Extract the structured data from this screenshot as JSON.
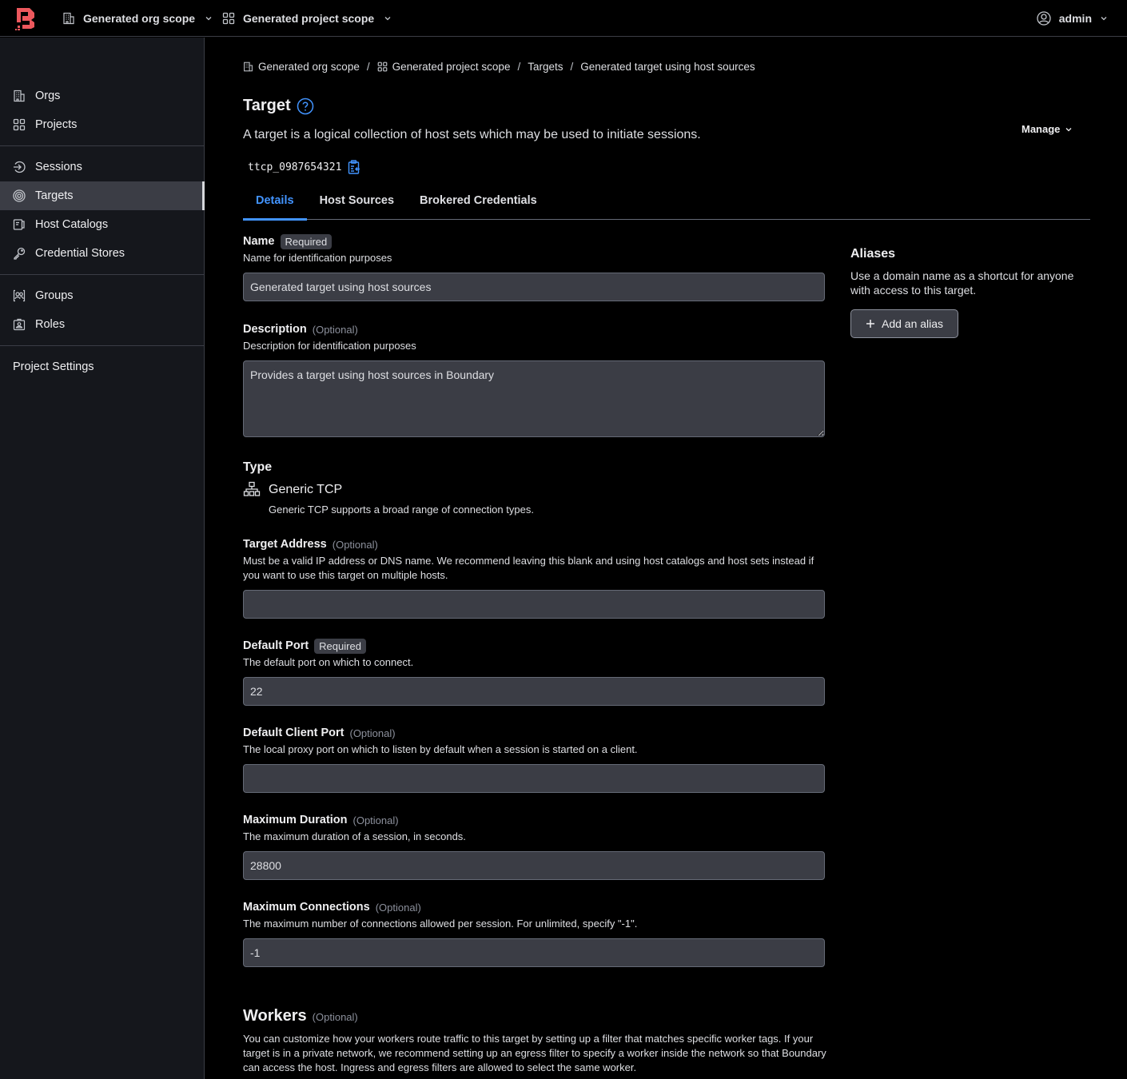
{
  "header": {
    "org_scope": "Generated org scope",
    "project_scope": "Generated project scope",
    "user": "admin",
    "brand_color": "#ec585d"
  },
  "sidebar": {
    "groups": [
      [
        {
          "label": "Orgs",
          "icon": "building-icon"
        },
        {
          "label": "Projects",
          "icon": "grid-icon"
        }
      ],
      [
        {
          "label": "Sessions",
          "icon": "entry-point-icon"
        },
        {
          "label": "Targets",
          "icon": "target-icon",
          "active": true
        },
        {
          "label": "Host Catalogs",
          "icon": "server-cluster-icon"
        },
        {
          "label": "Credential Stores",
          "icon": "key-icon"
        }
      ],
      [
        {
          "label": "Groups",
          "icon": "users-icon"
        },
        {
          "label": "Roles",
          "icon": "id-card-icon"
        }
      ],
      [
        {
          "label": "Project Settings"
        }
      ]
    ]
  },
  "breadcrumb": [
    "Generated org scope",
    "Generated project scope",
    "Targets",
    "Generated target using host sources"
  ],
  "page": {
    "title": "Target",
    "subtitle": "A target is a logical collection of host sets which may be used to initiate sessions.",
    "manage_label": "Manage",
    "target_id": "ttcp_0987654321",
    "accent_color": "#4294ff"
  },
  "tabs": [
    {
      "label": "Details",
      "active": true
    },
    {
      "label": "Host Sources"
    },
    {
      "label": "Brokered Credentials"
    }
  ],
  "form": {
    "required_badge": "Required",
    "optional_label": "(Optional)",
    "name": {
      "label": "Name",
      "helper": "Name for identification purposes",
      "value": "Generated target using host sources"
    },
    "description": {
      "label": "Description",
      "helper": "Description for identification purposes",
      "value": "Provides a target using host sources in Boundary"
    },
    "type": {
      "label": "Type",
      "value": "Generic TCP",
      "desc": "Generic TCP supports a broad range of connection types."
    },
    "address": {
      "label": "Target Address",
      "helper": "Must be a valid IP address or DNS name. We recommend leaving this blank and using host catalogs and host sets instead if you want to use this target on multiple hosts.",
      "value": ""
    },
    "default_port": {
      "label": "Default Port",
      "helper": "The default port on which to connect.",
      "value": "22"
    },
    "client_port": {
      "label": "Default Client Port",
      "helper": "The local proxy port on which to listen by default when a session is started on a client.",
      "value": ""
    },
    "max_duration": {
      "label": "Maximum Duration",
      "helper": "The maximum duration of a session, in seconds.",
      "value": "28800"
    },
    "max_connections": {
      "label": "Maximum Connections",
      "helper": "The maximum number of connections allowed per session. For unlimited, specify \"-1\".",
      "value": "-1"
    }
  },
  "workers": {
    "title": "Workers",
    "optional_label": "(Optional)",
    "desc": "You can customize how your workers route traffic to this target by setting up a filter that matches specific worker tags. If your target is in a private network, we recommend setting up an egress filter to specify a worker inside the network so that Boundary can access the host. Ingress and egress filters are allowed to select the same worker."
  },
  "aliases": {
    "title": "Aliases",
    "desc": "Use a domain name as a shortcut for anyone with access to this target.",
    "add_label": "Add an alias"
  }
}
